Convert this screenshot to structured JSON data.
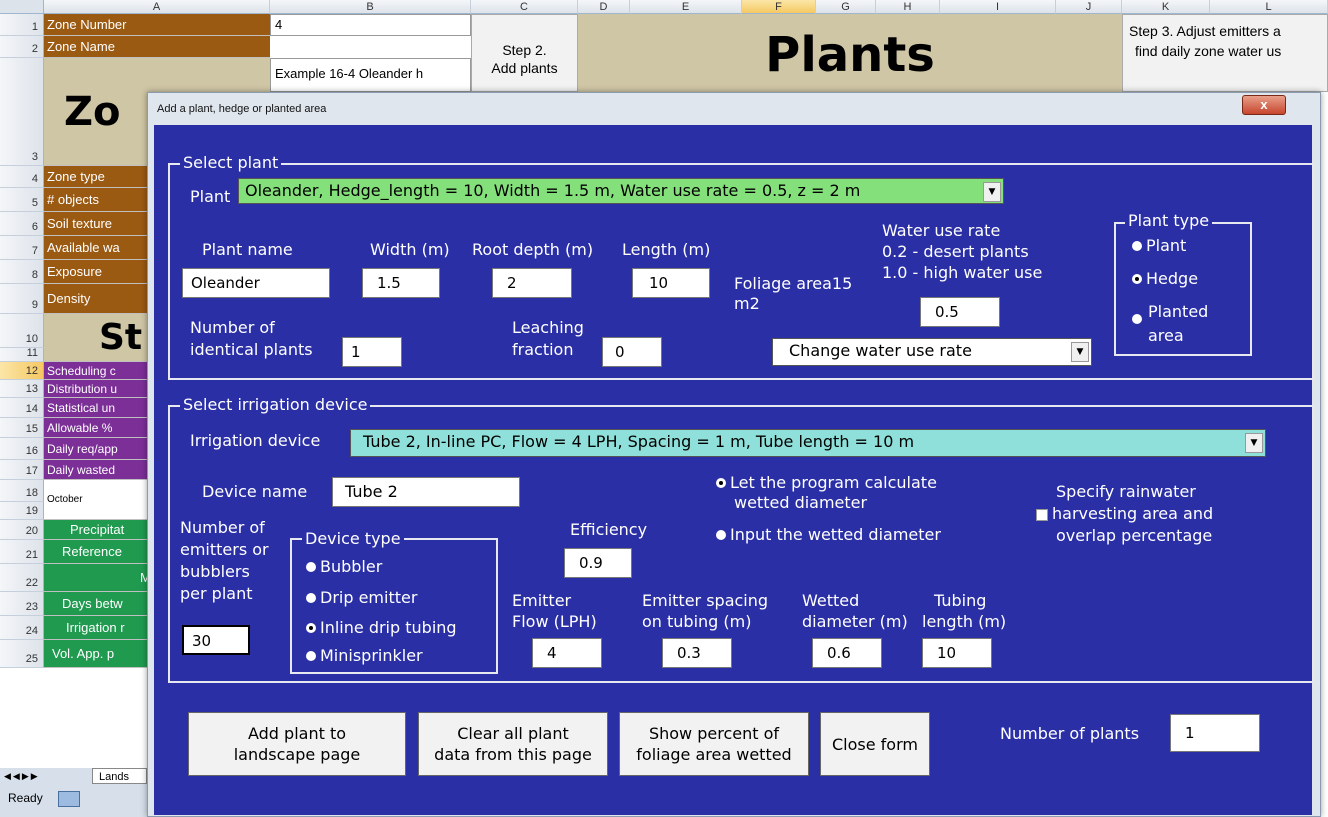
{
  "excel": {
    "columns": [
      "A",
      "B",
      "C",
      "D",
      "E",
      "F",
      "G",
      "H",
      "I",
      "J",
      "K",
      "L"
    ],
    "rows": [
      {
        "n": "1",
        "a": "Zone Number"
      },
      {
        "n": "2",
        "a": "Zone Name"
      },
      {
        "n": "3",
        "a": "Zo"
      },
      {
        "n": "4",
        "a": "Zone type"
      },
      {
        "n": "5",
        "a": "# objects"
      },
      {
        "n": "6",
        "a": "Soil texture"
      },
      {
        "n": "7",
        "a": "Available wa"
      },
      {
        "n": "8",
        "a": "Exposure"
      },
      {
        "n": "9",
        "a": "Density"
      },
      {
        "n": "10",
        "a": "St"
      },
      {
        "n": "11",
        "a": ""
      },
      {
        "n": "12",
        "a": "Scheduling c"
      },
      {
        "n": "13",
        "a": "Distribution u"
      },
      {
        "n": "14",
        "a": "Statistical un"
      },
      {
        "n": "15",
        "a": "Allowable %"
      },
      {
        "n": "16",
        "a": "Daily req/app"
      },
      {
        "n": "17",
        "a": "Daily wasted"
      },
      {
        "n": "18",
        "a": "October"
      },
      {
        "n": "19",
        "a": ""
      },
      {
        "n": "20",
        "a": "Precipitat"
      },
      {
        "n": "21",
        "a": "Reference"
      },
      {
        "n": "22",
        "a": "M"
      },
      {
        "n": "23",
        "a": "Days betw"
      },
      {
        "n": "24",
        "a": "Irrigation r"
      },
      {
        "n": "25",
        "a": "Vol. App. p"
      }
    ],
    "zone_number": "4",
    "zone_name": "Example 16-4 Oleander h",
    "step2": "Step 2.\nAdd plants",
    "plants_title": "Plants",
    "step3_line1": "Step 3. Adjust emitters a",
    "step3_line2": "find daily zone water us",
    "sheet_tab": "Lands",
    "status": "Ready"
  },
  "dialog": {
    "title": "Add a plant, hedge or planted area",
    "close": "x",
    "select_plant": {
      "legend": "Select plant",
      "plant_label": "Plant",
      "plant_value": "Oleander, Hedge_length = 10, Width = 1.5 m, Water use rate = 0.5, z = 2 m",
      "plant_name_label": "Plant name",
      "plant_name": "Oleander",
      "width_label": "Width (m)",
      "width": "1.5",
      "root_depth_label": "Root depth (m)",
      "root_depth": "2",
      "length_label": "Length (m)",
      "length": "10",
      "foliage_line1": "Foliage area15",
      "foliage_line2": "m2",
      "wur_line1": "Water use rate",
      "wur_line2": "0.2 - desert plants",
      "wur_line3": "1.0 - high water use",
      "wur_value": "0.5",
      "identical_line1": "Number of",
      "identical_line2": "identical plants",
      "identical_value": "1",
      "leaching_line1": "Leaching",
      "leaching_line2": "fraction",
      "leaching_value": "0",
      "change_wur": "Change water use rate",
      "plant_type": {
        "legend": "Plant type",
        "plant": "Plant",
        "hedge": "Hedge",
        "planted_line1": "Planted",
        "planted_line2": "area",
        "selected": "Hedge"
      }
    },
    "irrigation": {
      "legend": "Select irrigation device",
      "device_label": "Irrigation device",
      "device_value": "Tube 2, In-line PC, Flow = 4 LPH, Spacing = 1 m, Tube length = 10 m",
      "device_name_label": "Device name",
      "device_name": "Tube 2",
      "let_calc_line1": "Let the program calculate",
      "let_calc_line2": "wetted diameter",
      "input_wetted": "Input the wetted diameter",
      "rain_line1": "Specify rainwater",
      "rain_line2": "harvesting area and",
      "rain_line3": "overlap percentage",
      "emitters_line1": "Number of",
      "emitters_line2": "emitters or",
      "emitters_line3": "bubblers",
      "emitters_line4": "per plant",
      "emitters_value": "30",
      "device_type": {
        "legend": "Device type",
        "bubbler": "Bubbler",
        "drip": "Drip emitter",
        "inline": "Inline drip tubing",
        "mini": "Minisprinkler",
        "selected": "Inline drip tubing"
      },
      "efficiency_label": "Efficiency",
      "efficiency": "0.9",
      "flow_line1": "Emitter",
      "flow_line2": "Flow (LPH)",
      "flow": "4",
      "spacing_line1": "Emitter spacing",
      "spacing_line2": "on tubing (m)",
      "spacing": "0.3",
      "wetted_line1": "Wetted",
      "wetted_line2": "diameter (m)",
      "wetted": "0.6",
      "tubing_line1": "Tubing",
      "tubing_line2": "length (m)",
      "tubing": "10"
    },
    "buttons": {
      "add_line1": "Add plant to",
      "add_line2": "landscape page",
      "clear_line1": "Clear all plant",
      "clear_line2": "data from this page",
      "show_line1": "Show percent of",
      "show_line2": "foliage area wetted",
      "close": "Close form"
    },
    "num_plants_label": "Number of plants",
    "num_plants": "1"
  },
  "colors": {
    "panel": "#2a2fa6",
    "plant_combo": "#84e07a",
    "device_combo": "#8fe0da",
    "brown": "#9b5a12",
    "purple": "#7b2f97",
    "green": "#1f9a4f"
  }
}
